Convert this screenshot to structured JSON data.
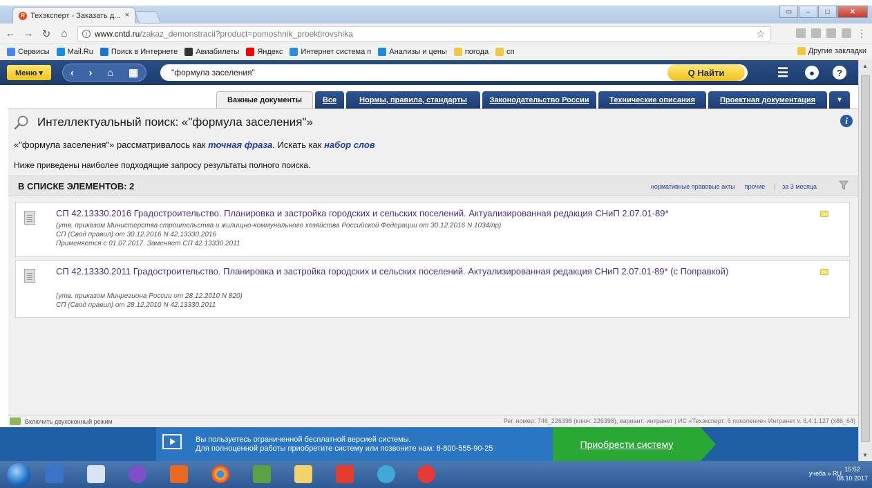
{
  "browser": {
    "tab_title": "Техэксперт - Заказать д...",
    "tab_close": "×",
    "url_host": "www.cntd.ru",
    "url_path": "/zakaz_demonstracii?product=pomoshnik_proektirovshika",
    "bookmarks": [
      {
        "label": "Сервисы",
        "icon": "apps-icon",
        "color": "#4285f4"
      },
      {
        "label": "Mail.Ru",
        "icon": "mailru-icon",
        "color": "#168de2"
      },
      {
        "label": "Поиск в Интернете",
        "icon": "search-icon",
        "color": "#1976d2"
      },
      {
        "label": "Авиабилеты",
        "icon": "plane-icon",
        "color": "#333333"
      },
      {
        "label": "Яндекс",
        "icon": "yandex-icon",
        "color": "#ff0000"
      },
      {
        "label": "Интернет система п",
        "icon": "globe-icon",
        "color": "#2b8de8"
      },
      {
        "label": "Анализы и цены",
        "icon": "drop-icon",
        "color": "#1e88e5"
      },
      {
        "label": "погода",
        "icon": "folder-icon",
        "color": "#f5c842"
      },
      {
        "label": "сп",
        "icon": "folder-icon",
        "color": "#f5c842"
      }
    ],
    "other_bookmarks": "Другие закладки"
  },
  "toolbar": {
    "menu_label": "Меню ▾",
    "search_value": "\"формула заселения\"",
    "find_label": "Q  Найти"
  },
  "tabs": [
    {
      "label": "Важные документы",
      "active": true
    },
    {
      "label": "Все",
      "active": false
    },
    {
      "label": "Нормы, правила, стандарты",
      "active": false
    },
    {
      "label": "Законодательство России",
      "active": false
    },
    {
      "label": "Технические описания",
      "active": false
    },
    {
      "label": "Проектная документация",
      "active": false
    },
    {
      "label": "▾",
      "active": false
    }
  ],
  "search": {
    "heading": "Интеллектуальный поиск: «\"формула заселения\"»",
    "query_prefix": "«\"формула заселения\"» рассматривалось как ",
    "exact_phrase": "точная фраза",
    "search_as": ". Искать как ",
    "word_set": "набор слов",
    "explanation": "Ниже приведены наиболее подходящие запросу результаты полного поиска."
  },
  "list": {
    "title": "В СПИСКЕ ЭЛЕМЕНТОВ: 2",
    "filters": [
      "нормативные правовые акты",
      "прочие",
      "за 3 месяца"
    ]
  },
  "documents": [
    {
      "title": "СП 42.13330.2016 Градостроительство. Планировка и застройка городских и сельских поселений. Актуализированная редакция СНиП 2.07.01-89*",
      "meta": [
        "(утв. приказом Министерства строительства и жилищно-коммунального хозяйства Российской Федерации от 30.12.2016 N 1034/пр)",
        "СП (Свод правил) от 30.12.2016 N 42.13330.2016",
        "Применяется с 01.07.2017. Заменяет СП 42.13330.2011"
      ]
    },
    {
      "title": "СП 42.13330.2011 Градостроительство. Планировка и застройка городских и сельских поселений. Актуализированная редакция СНиП 2.07.01-89* (с Поправкой)",
      "meta": [
        "(утв. приказом Минрегиона России от 28.12.2010 N 820)",
        "СП (Свод правил) от 28.12.2010 N 42.13330.2011"
      ]
    }
  ],
  "status": {
    "dual_window": "Включить двухоконный режим",
    "reg_info": "Рег. номер: 746_226398 (ключ: 226398), вариант: интранет   |   ИС «Техэксперт: 6 поколение» Интранет v. 6.4.1.127 (x86_64)"
  },
  "promo": {
    "line1": "Вы пользуетесь ограниченной бесплатной версией системы.",
    "line2": "Для полноценной работы приобретите систему или позвоните нам: 8-800-555-90-25",
    "buy_label": "Приобрести систему"
  },
  "taskbar": {
    "tray_text": "учеба  »  RU",
    "time": "15:52",
    "date": "08.10.2017"
  },
  "colors": {
    "toolbar_blue": "#1c3b6b",
    "accent_yellow": "#f3c516",
    "link_purple": "#4b2d83",
    "promo_green": "#2aa836"
  }
}
